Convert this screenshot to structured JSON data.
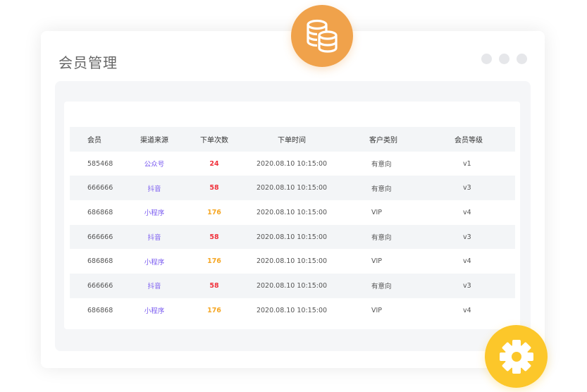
{
  "window": {
    "title": "会员管理"
  },
  "table": {
    "headers": [
      "会员",
      "渠道来源",
      "下单次数",
      "下单时间",
      "客户类别",
      "会员等级"
    ],
    "rows": [
      {
        "member": "585468",
        "channel": "公众号",
        "orders": "24",
        "time": "2020.08.10  10:15:00",
        "category": "有意向",
        "level": "v1",
        "orders_color": "red"
      },
      {
        "member": "666666",
        "channel": "抖音",
        "orders": "58",
        "time": "2020.08.10  10:15:00",
        "category": "有意向",
        "level": "v3",
        "orders_color": "red"
      },
      {
        "member": "686868",
        "channel": "小程序",
        "orders": "176",
        "time": "2020.08.10  10:15:00",
        "category": "VIP",
        "level": "v4",
        "orders_color": "orange"
      },
      {
        "member": "666666",
        "channel": "抖音",
        "orders": "58",
        "time": "2020.08.10  10:15:00",
        "category": "有意向",
        "level": "v3",
        "orders_color": "red"
      },
      {
        "member": "686868",
        "channel": "小程序",
        "orders": "176",
        "time": "2020.08.10  10:15:00",
        "category": "VIP",
        "level": "v4",
        "orders_color": "orange"
      },
      {
        "member": "666666",
        "channel": "抖音",
        "orders": "58",
        "time": "2020.08.10  10:15:00",
        "category": "有意向",
        "level": "v3",
        "orders_color": "red"
      },
      {
        "member": "686868",
        "channel": "小程序",
        "orders": "176",
        "time": "2020.08.10  10:15:00",
        "category": "VIP",
        "level": "v4",
        "orders_color": "orange"
      }
    ]
  },
  "icons": {
    "top_badge": "database-icon",
    "bottom_badge": "gear-icon"
  },
  "colors": {
    "channel": "#7b5cf0",
    "orders_red": "#f0313b",
    "orders_orange": "#f5a623",
    "database_badge": "#f0a24b",
    "gear_badge": "#fcc72a"
  }
}
